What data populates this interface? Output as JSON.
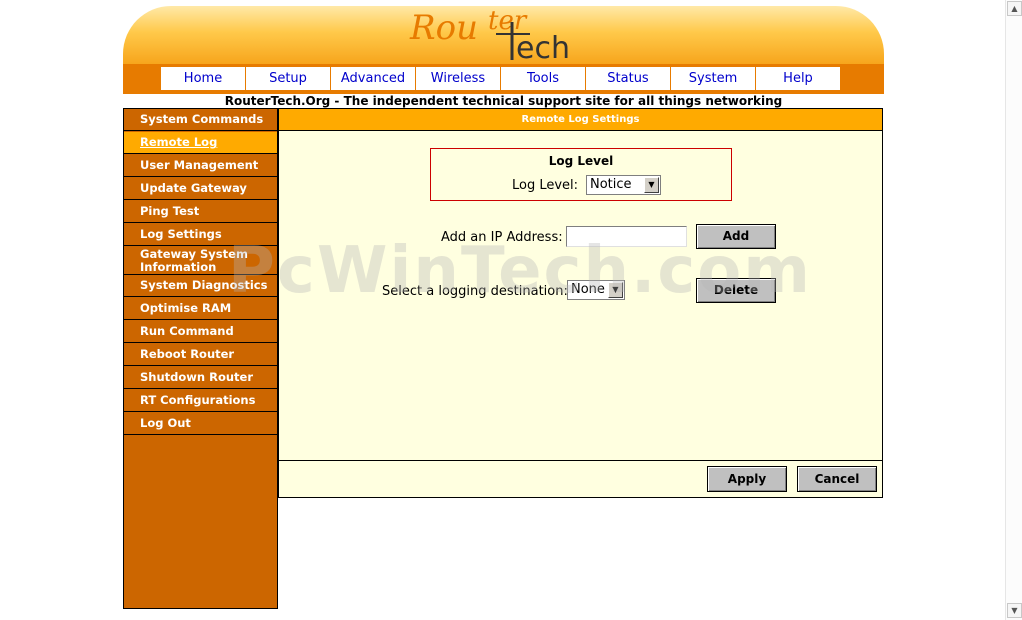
{
  "logo": {
    "part1": "Rou",
    "part2": "ter",
    "part3": "ech",
    "t_letter": "T"
  },
  "nav": [
    "Home",
    "Setup",
    "Advanced",
    "Wireless",
    "Tools",
    "Status",
    "System",
    "Help"
  ],
  "tagline": "RouterTech.Org - The independent technical support site for all things networking",
  "sidebar": {
    "items": [
      "System Commands",
      "Remote Log",
      "User Management",
      "Update Gateway",
      "Ping Test",
      "Log Settings",
      "Gateway System Information",
      "System Diagnostics",
      "Optimise RAM",
      "Run Command",
      "Reboot Router",
      "Shutdown Router",
      "RT Configurations",
      "Log Out"
    ],
    "active_index": 1
  },
  "panel": {
    "title": "Remote Log Settings",
    "log_box_title": "Log Level",
    "log_level_label": "Log Level:",
    "log_level_value": "Notice",
    "ip_label": "Add an IP Address:",
    "ip_value": "",
    "add_button": "Add",
    "dest_label": "Select a logging destination:",
    "dest_value": "None",
    "delete_button": "Delete",
    "apply_button": "Apply",
    "cancel_button": "Cancel"
  },
  "watermark": "PcWinTech.com",
  "colors": {
    "accent_orange": "#e77b00",
    "sidebar_bg": "#cc6600",
    "highlight": "#ffaa00",
    "panel_bg": "#ffffe0",
    "link_blue": "#0000cc"
  }
}
